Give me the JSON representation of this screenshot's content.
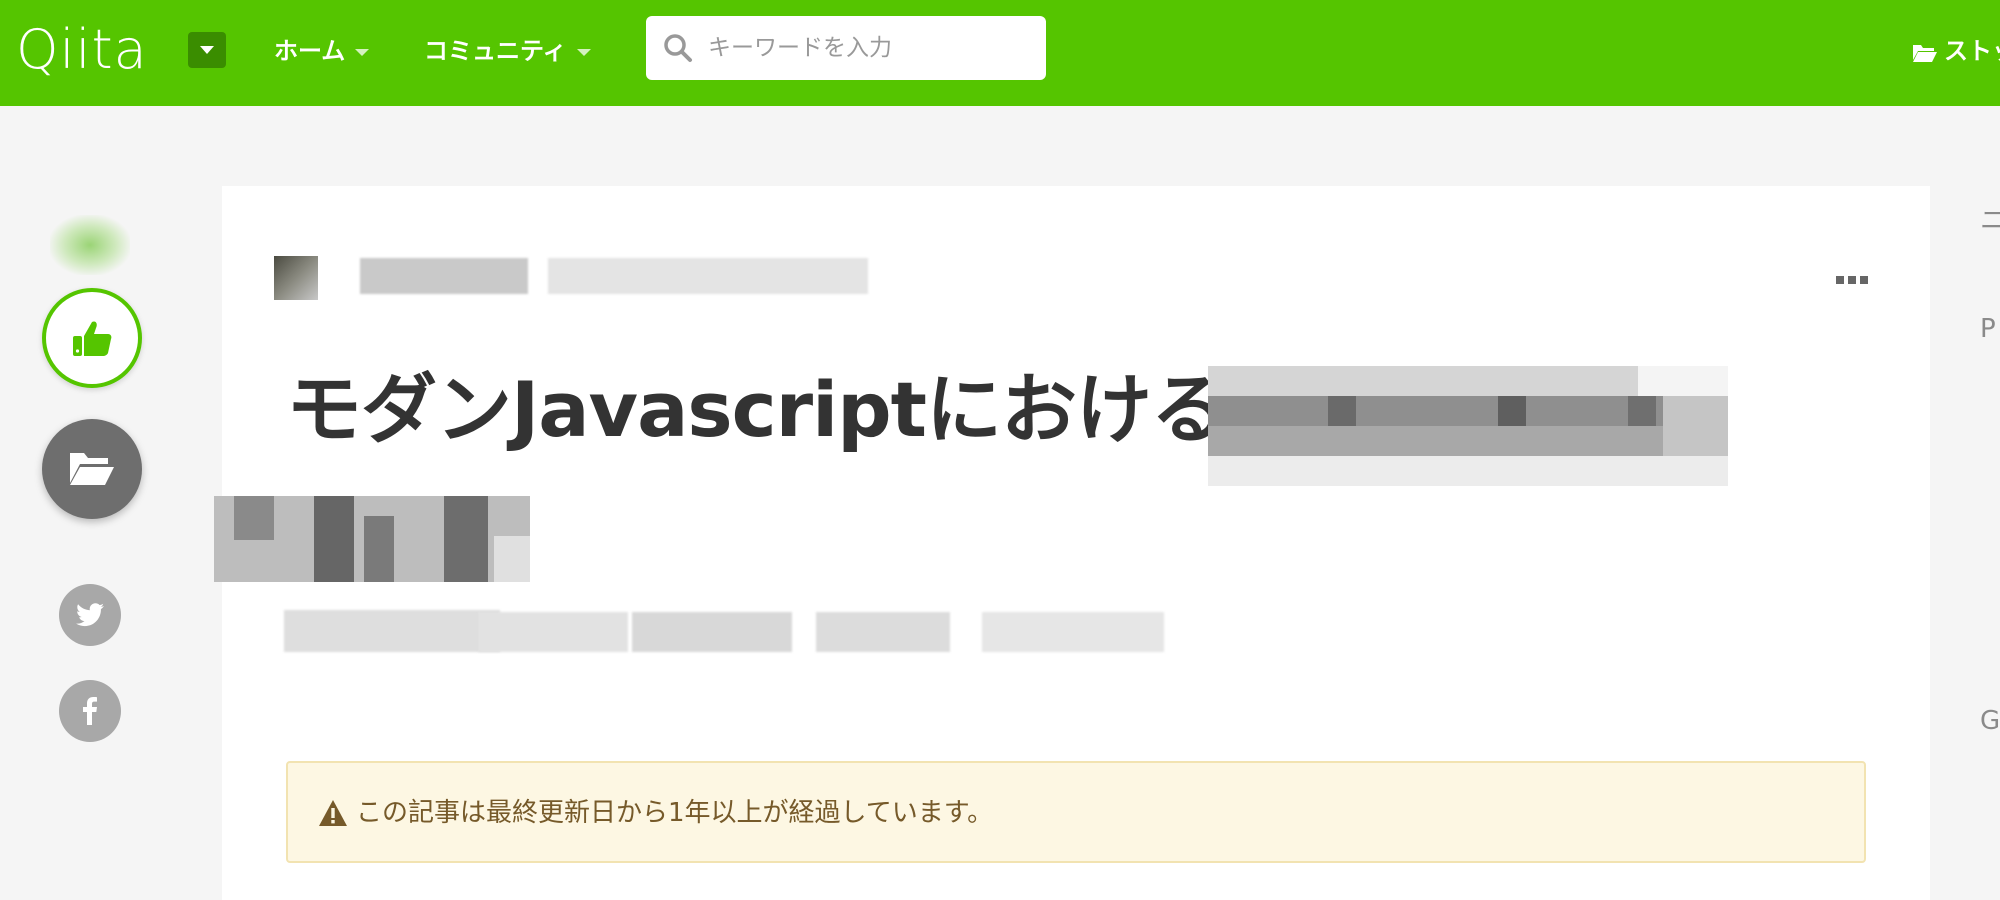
{
  "header": {
    "logo_text": "Qiita",
    "nav": [
      {
        "label": "ホーム"
      },
      {
        "label": "コミュニティ"
      }
    ],
    "search": {
      "placeholder": "キーワードを入力"
    },
    "right_link": "ストック"
  },
  "article": {
    "title_visible": "モダンJavascriptにおける",
    "alert_text": "この記事は最終更新日から1年以上が経過しています。"
  },
  "sidebar_right_letters": [
    "ニ",
    "P",
    "G"
  ],
  "colors": {
    "brand": "#55c500",
    "alert_bg": "#fdf7e3",
    "alert_text": "#765a2a"
  },
  "icons": {
    "like": "thumbs-up-icon",
    "stock": "folder-open-icon",
    "twitter": "twitter-icon",
    "facebook": "facebook-icon",
    "search": "search-icon",
    "more": "more-horizontal-icon",
    "alert": "warning-icon"
  }
}
